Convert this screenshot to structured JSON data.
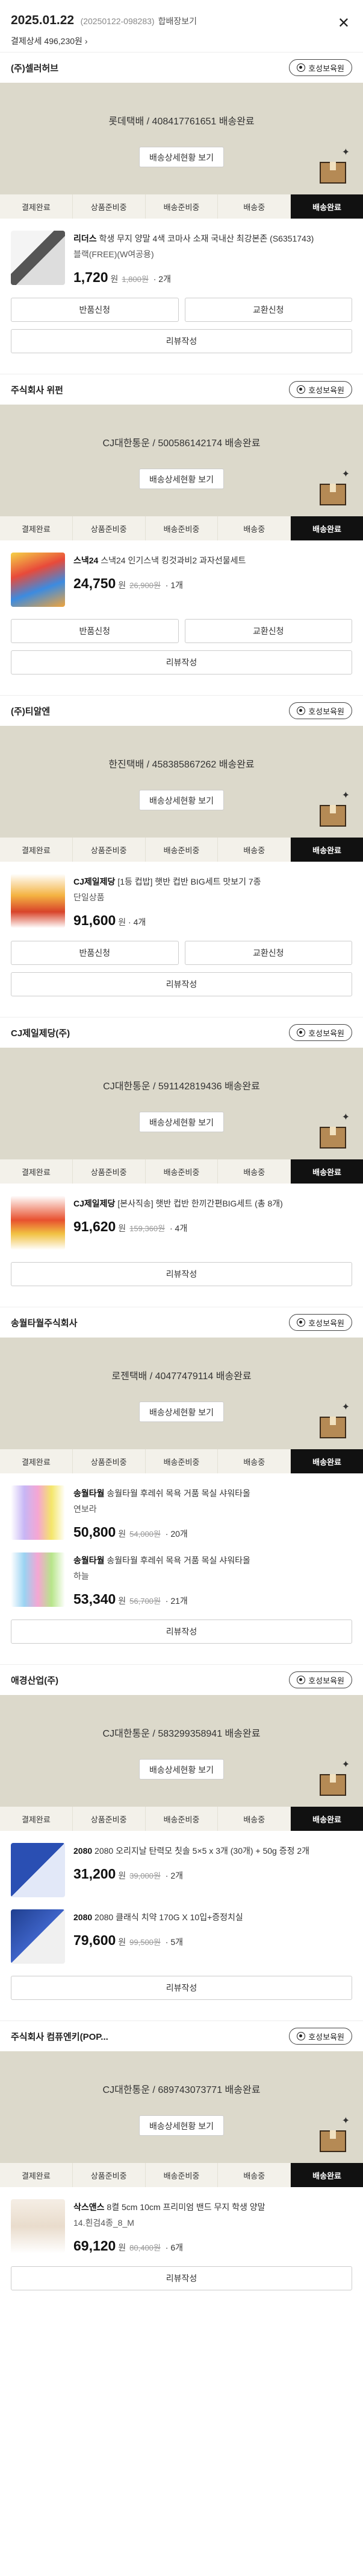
{
  "header": {
    "date": "2025.01.22",
    "order_id": "(20250122-098283)",
    "merge_label": "합배장보기",
    "pay_label": "결제상세 496,230원",
    "close_icon": "close-icon"
  },
  "common": {
    "shop_button": "호성보육원",
    "view_delivery": "배송상세현황 보기",
    "return_label": "반품신청",
    "exchange_label": "교환신청",
    "review_label": "리뷰작성",
    "currency": "원",
    "steps": [
      "결제완료",
      "상품준비중",
      "배송준비중",
      "배송중",
      "배송완료"
    ],
    "active_step": 4
  },
  "orders": [
    {
      "shop": "(주)셀러허브",
      "tracking": "롯데택배 / 408417761651 배송완료",
      "products": [
        {
          "brand": "리더스",
          "title": "학생 무지 양말 4색 코마사 소재 국내산 최강본존 (S6351743)",
          "option": "블랙(FREE)(W여공용)",
          "price": "1,720",
          "orig": "1,800원",
          "qty": "2개"
        }
      ],
      "show_return": true
    },
    {
      "shop": "주식회사 위펀",
      "tracking": "CJ대한통운 / 500586142174 배송완료",
      "products": [
        {
          "brand": "스낵24",
          "title": "스낵24 인기스낵 킹것과비2 과자선물세트",
          "option": "",
          "price": "24,750",
          "orig": "26,900원",
          "qty": "1개"
        }
      ],
      "show_return": true
    },
    {
      "shop": "(주)티알엔",
      "tracking": "한진택배 / 458385867262 배송완료",
      "products": [
        {
          "brand": "CJ제일제당",
          "title": "[1등 컵밥] 햇반 컵반 BIG세트 맛보기 7종",
          "option": "단일상품",
          "price": "91,600",
          "orig": "",
          "qty": "4개"
        }
      ],
      "show_return": true
    },
    {
      "shop": "CJ제일제당(주)",
      "tracking": "CJ대한통운 / 591142819436 배송완료",
      "products": [
        {
          "brand": "CJ제일제당",
          "title": "[본사직송] 햇반 컵반 한끼간편BIG세트 (총 8개)",
          "option": "",
          "price": "91,620",
          "orig": "159,360원",
          "qty": "4개"
        }
      ],
      "show_return": false
    },
    {
      "shop": "송월타월주식회사",
      "tracking": "로젠택배 / 40477479114 배송완료",
      "products": [
        {
          "brand": "송월타월",
          "title": "송월타월 후레쉬 목욕 거품 목실 샤워타올",
          "option": "연보라",
          "price": "50,800",
          "orig": "54,000원",
          "qty": "20개"
        },
        {
          "brand": "송월타월",
          "title": "송월타월 후레쉬 목욕 거품 목실 샤워타올",
          "option": "하늘",
          "price": "53,340",
          "orig": "56,700원",
          "qty": "21개"
        }
      ],
      "show_return": false
    },
    {
      "shop": "애경산업(주)",
      "tracking": "CJ대한통운 / 583299358941 배송완료",
      "products": [
        {
          "brand": "2080",
          "title": "2080 오리지날 탄력모 칫솔 5×5 x 3개 (30개) + 50g 증정 2개",
          "option": "",
          "price": "31,200",
          "orig": "39,000원",
          "qty": "2개"
        },
        {
          "brand": "2080",
          "title": "2080 클래식 치약 170G X 10입+증정치실",
          "option": "",
          "price": "79,600",
          "orig": "99,500원",
          "qty": "5개"
        }
      ],
      "show_return": false
    },
    {
      "shop": "주식회사 컴퓨엔키(POP...",
      "tracking": "CJ대한통운 / 689743073771 배송완료",
      "products": [
        {
          "brand": "삭스앤스",
          "title": "8켤 5cm 10cm 프리미엄 밴드 무지 학생 양말",
          "option": "14.흰검4종_8_M",
          "price": "69,120",
          "orig": "80,400원",
          "qty": "6개"
        }
      ],
      "show_return": false
    }
  ]
}
